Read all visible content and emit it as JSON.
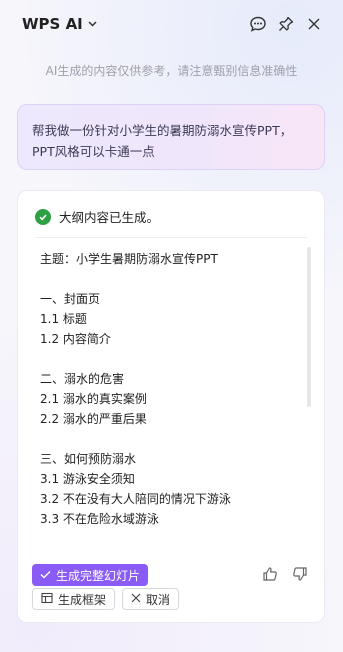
{
  "header": {
    "title": "WPS AI",
    "icons": [
      "chevron-down-icon",
      "chat-bubble-icon",
      "pin-icon",
      "close-icon"
    ]
  },
  "disclaimer": "AI生成的内容仅供参考，请注意甄别信息准确性",
  "user_prompt": "帮我做一份针对小学生的暑期防溺水宣传PPT，PPT风格可以卡通一点",
  "result": {
    "status": "大纲内容已生成。",
    "outline": [
      "主题：小学生暑期防溺水宣传PPT",
      "",
      "一、封面页",
      "1.1 标题",
      "1.2 内容简介",
      "",
      "二、溺水的危害",
      "2.1 溺水的真实案例",
      "2.2 溺水的严重后果",
      "",
      "三、如何预防溺水",
      "3.1 游泳安全须知",
      "3.2 不在没有大人陪同的情况下游泳",
      "3.3 不在危险水域游泳"
    ]
  },
  "actions": {
    "generate_slides": "生成完整幻灯片",
    "generate_frame": "生成框架",
    "cancel": "取消"
  },
  "colors": {
    "accent": "#8a5cf5",
    "success": "#2ea043"
  }
}
